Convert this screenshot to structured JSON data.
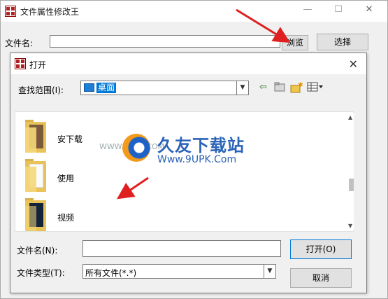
{
  "main_window": {
    "title": "文件属性修改王",
    "min_icon": "—",
    "max_icon": "☐",
    "close_icon": "✕",
    "file_label": "文件名:",
    "file_value": "",
    "browse_button": "浏览",
    "select_button": "选择"
  },
  "dialog": {
    "title": "打开",
    "close_icon": "✕",
    "look_in_label": "查找范围(I):",
    "look_in_value": "桌面",
    "folders": [
      {
        "name": "安下载"
      },
      {
        "name": "使用"
      },
      {
        "name": "视频"
      }
    ],
    "file_name_label": "文件名(N):",
    "file_name_value": "",
    "file_type_label": "文件类型(T):",
    "file_type_value": "所有文件(*.*)",
    "open_button": "打开(O)",
    "cancel_button": "取消"
  },
  "watermark": {
    "cn": "久友下载站",
    "en": "Www.9UPK.Com",
    "small": "WWW.9UPK.COM"
  },
  "colors": {
    "selection": "#0078d7",
    "arrow": "#e02020",
    "watermark": "#2a63b8"
  }
}
